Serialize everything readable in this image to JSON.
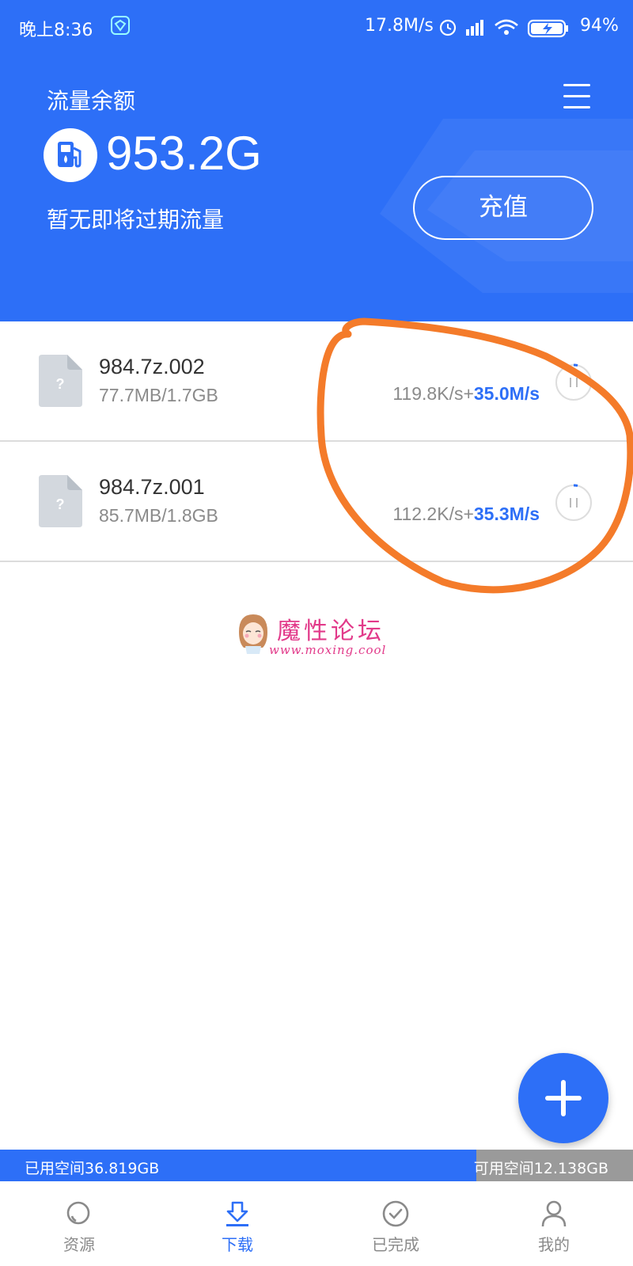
{
  "status_bar": {
    "time": "晚上8:36",
    "network_speed": "17.8M/s",
    "battery": "94%"
  },
  "header": {
    "balance_label": "流量余额",
    "balance_value": "953.2G",
    "expire_note": "暂无即将过期流量",
    "recharge_label": "充值"
  },
  "downloads": [
    {
      "name": "984.7z.002",
      "size": "77.7MB/1.7GB",
      "speed_normal": "119.8K/s+",
      "speed_boost": "35.0M/s"
    },
    {
      "name": "984.7z.001",
      "size": "85.7MB/1.8GB",
      "speed_normal": "112.2K/s+",
      "speed_boost": "35.3M/s"
    }
  ],
  "watermark": {
    "title": "魔性论坛",
    "url": "www.moxing.cool"
  },
  "storage": {
    "used": "已用空间36.819GB",
    "free": "可用空间12.138GB",
    "used_fraction": 0.752
  },
  "nav": {
    "items": [
      {
        "label": "资源",
        "icon": "search-icon"
      },
      {
        "label": "下载",
        "icon": "download-icon"
      },
      {
        "label": "已完成",
        "icon": "check-circle-icon"
      },
      {
        "label": "我的",
        "icon": "person-icon"
      }
    ],
    "active_index": 1
  },
  "colors": {
    "primary": "#2d6ff7",
    "annotation": "#f47b2a",
    "watermark": "#e23a8a"
  }
}
